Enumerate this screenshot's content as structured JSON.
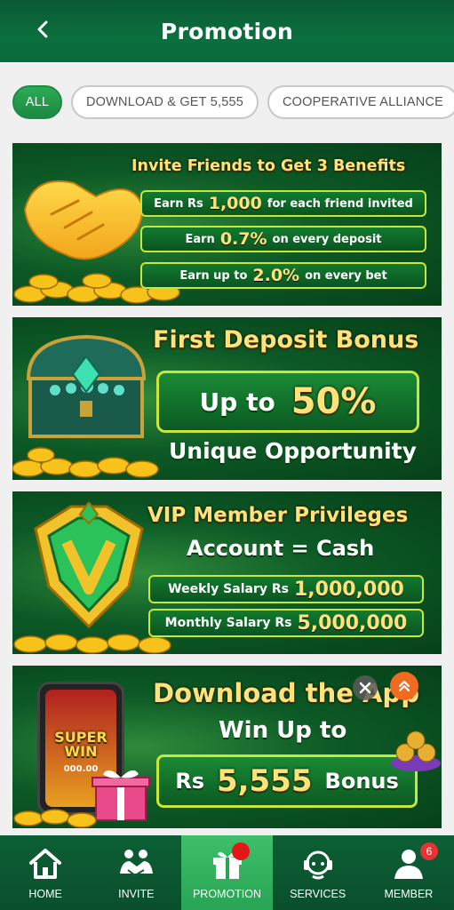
{
  "header": {
    "title": "Promotion"
  },
  "filters": [
    {
      "label": "ALL"
    },
    {
      "label": "DOWNLOAD & GET 5,555"
    },
    {
      "label": "COOPERATIVE ALLIANCE"
    }
  ],
  "banners": {
    "invite": {
      "title": "Invite Friends to Get 3 Benefits",
      "rows": [
        {
          "pre": "Earn Rs",
          "value": "1,000",
          "post": "for each friend invited"
        },
        {
          "pre": "Earn",
          "value": "0.7%",
          "post": "on every deposit"
        },
        {
          "pre": "Earn up to",
          "value": "2.0%",
          "post": "on every bet"
        }
      ]
    },
    "deposit": {
      "title": "First Deposit Bonus",
      "pill_pre": "Up to",
      "pill_value": "50%",
      "subtitle": "Unique Opportunity"
    },
    "vip": {
      "title": "VIP Member Privileges",
      "subtitle": "Account = Cash",
      "rows": [
        {
          "pre": "Weekly Salary Rs",
          "value": "1,000,000"
        },
        {
          "pre": "Monthly Salary Rs",
          "value": "5,000,000"
        }
      ]
    },
    "app": {
      "title": "Download the App",
      "subtitle": "Win Up to",
      "pill_pre": "Rs",
      "pill_value": "5,555",
      "pill_post": "Bonus",
      "phone_text": "SUPER WIN",
      "phone_amount": "000.00"
    }
  },
  "nav": [
    {
      "label": "HOME",
      "icon": "home-icon"
    },
    {
      "label": "INVITE",
      "icon": "handshake-icon"
    },
    {
      "label": "PROMOTION",
      "icon": "gift-icon"
    },
    {
      "label": "SERVICES",
      "icon": "headset-icon"
    },
    {
      "label": "MEMBER",
      "icon": "user-icon",
      "badge": "6"
    }
  ],
  "colors": {
    "brand_green": "#0b6f3e",
    "accent_gold": "#ffe27a",
    "badge_red": "#e53232"
  }
}
